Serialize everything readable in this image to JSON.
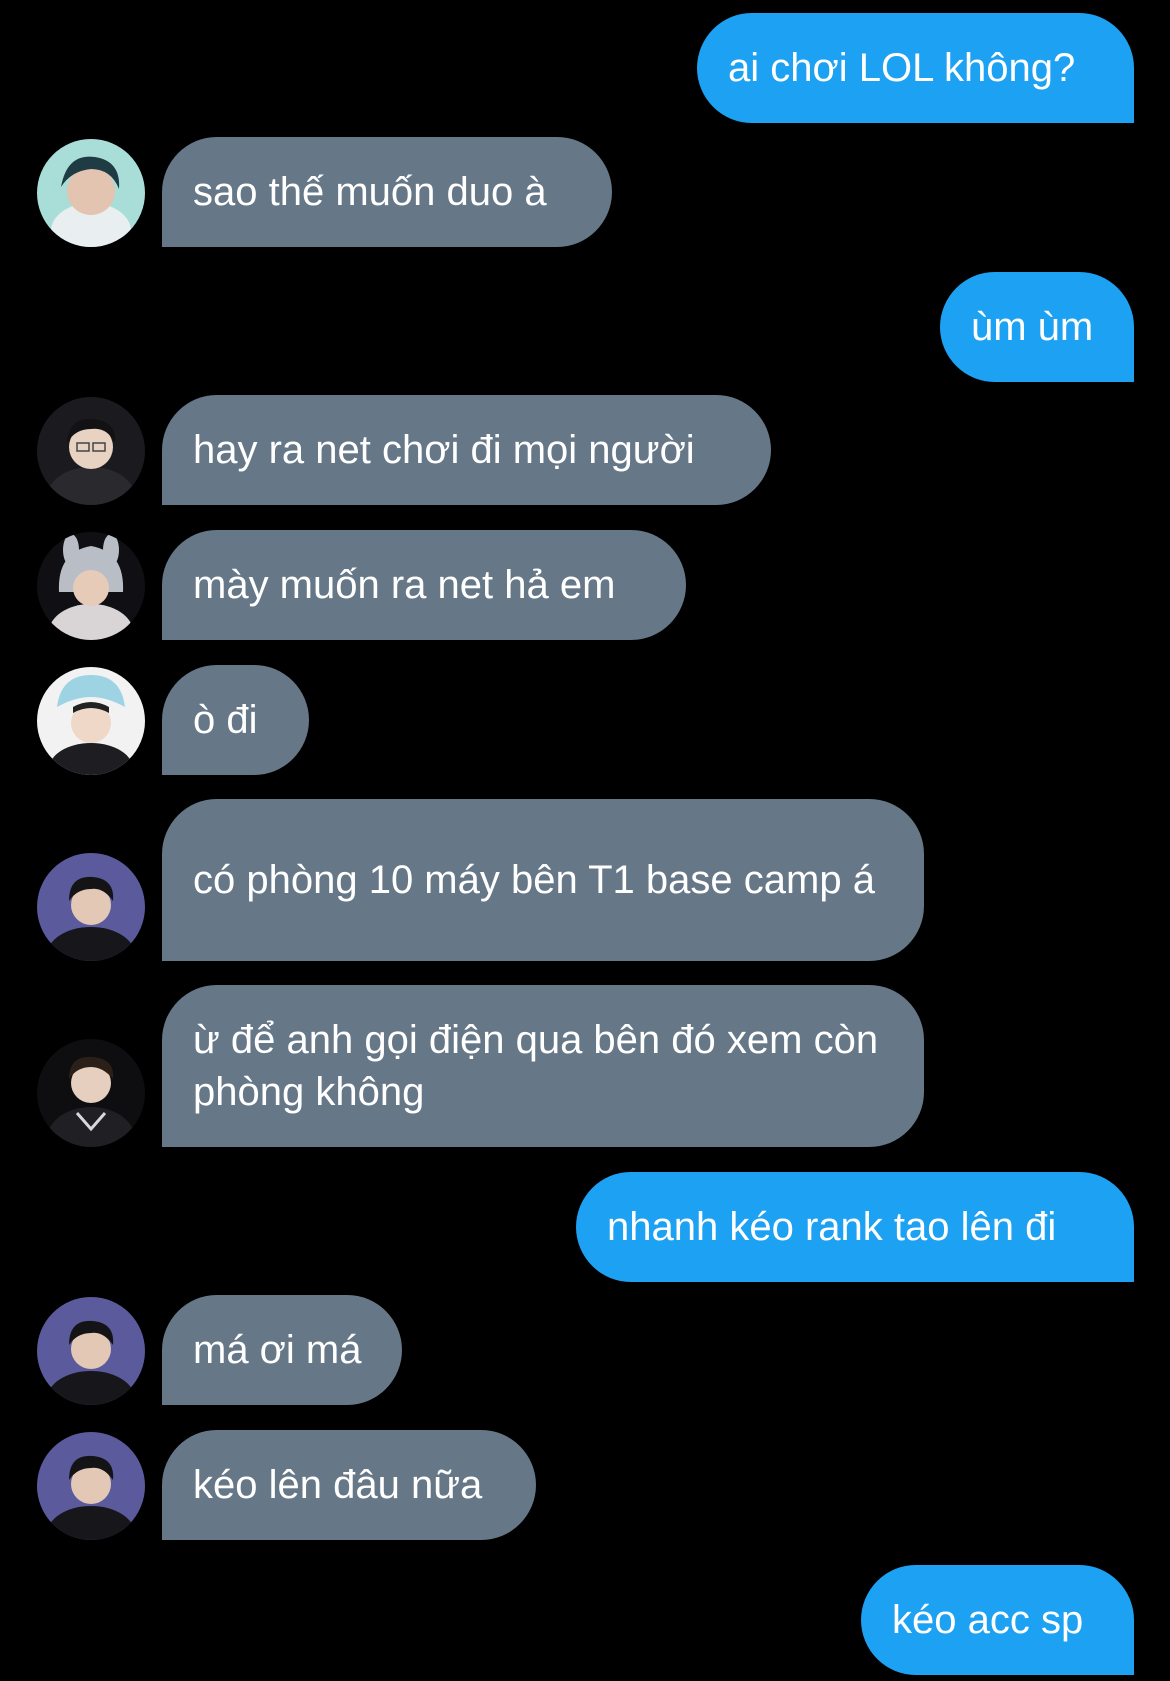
{
  "colors": {
    "background": "#000000",
    "outgoing_bubble": "#1da1f2",
    "incoming_bubble": "#667787",
    "text": "#ffffff"
  },
  "messages": [
    {
      "direction": "outgoing",
      "text": "ai chơi LOL không?"
    },
    {
      "direction": "incoming",
      "avatar": "avatar-photo",
      "text": "sao thế muốn duo à"
    },
    {
      "direction": "outgoing",
      "text": "ùm ùm"
    },
    {
      "direction": "incoming",
      "avatar": "avatar-photo",
      "text": "hay ra net chơi đi mọi người"
    },
    {
      "direction": "incoming",
      "avatar": "avatar-photo",
      "text": "mày muốn ra net hả em"
    },
    {
      "direction": "incoming",
      "avatar": "avatar-photo",
      "text": "ò đi"
    },
    {
      "direction": "incoming",
      "avatar": "avatar-photo",
      "text": "có phòng 10 máy bên T1 base camp á"
    },
    {
      "direction": "incoming",
      "avatar": "avatar-photo",
      "text": "ừ để anh gọi điện qua bên đó xem còn phòng không"
    },
    {
      "direction": "outgoing",
      "text": "nhanh kéo rank tao lên đi"
    },
    {
      "direction": "incoming",
      "avatar": "avatar-photo",
      "text": "má ơi má"
    },
    {
      "direction": "incoming",
      "avatar": "avatar-photo",
      "text": "kéo lên đâu nữa"
    },
    {
      "direction": "outgoing",
      "text": "kéo acc sp"
    }
  ]
}
